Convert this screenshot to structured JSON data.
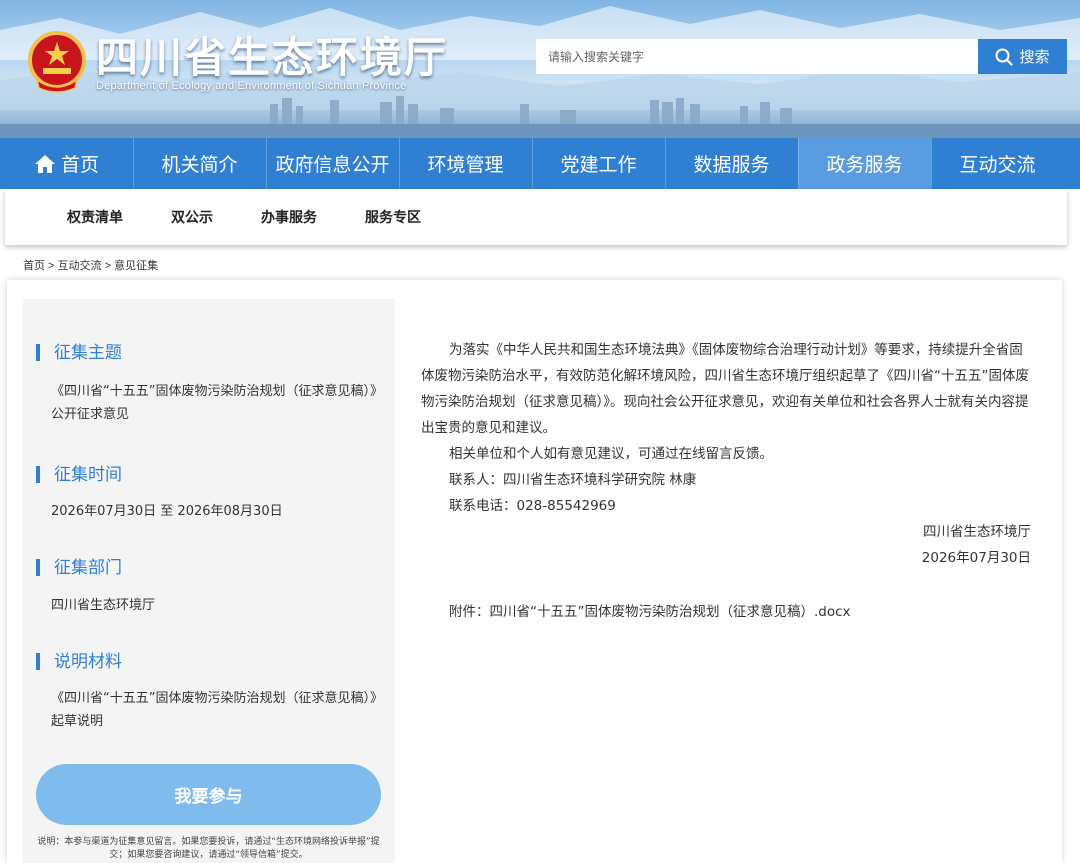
{
  "header": {
    "site_title": "四川省生态环境厅",
    "site_subtitle": "Department of Ecology and Environment of Sichuan Province",
    "search_placeholder": "请输入搜索关键字",
    "search_button": "搜索"
  },
  "nav": {
    "items": [
      {
        "label": "首页",
        "icon": "home-icon"
      },
      {
        "label": "机关简介"
      },
      {
        "label": "政府信息公开"
      },
      {
        "label": "环境管理"
      },
      {
        "label": "党建工作"
      },
      {
        "label": "数据服务"
      },
      {
        "label": "政务服务",
        "active": true
      },
      {
        "label": "互动交流"
      }
    ]
  },
  "subnav": {
    "items": [
      "权责清单",
      "双公示",
      "办事服务",
      "服务专区"
    ]
  },
  "breadcrumb": {
    "items": [
      "首页",
      "互动交流",
      "意见征集"
    ],
    "separator": " > "
  },
  "sidebar": {
    "topic_title": "征集主题",
    "topic_text": "《四川省“十五五”固体废物污染防治规划（征求意见稿）》公开征求意见",
    "time_title": "征集时间",
    "time_text": "2026年07月30日 至 2026年08月30日",
    "dept_title": "征集部门",
    "dept_text": "四川省生态环境厅",
    "material_title": "说明材料",
    "material_text": "《四川省“十五五”固体废物污染防治规划（征求意见稿）》起草说明",
    "participate_button": "我要参与",
    "note": "说明：本参与渠道为征集意见留言。如果您要投诉，请通过“生态环境网络投诉举报”提交；如果您要咨询建议，请通过“领导信箱”提交。"
  },
  "content": {
    "paragraph1": "为落实《中华人民共和国生态环境法典》《固体废物综合治理行动计划》等要求，持续提升全省固体废物污染防治水平，有效防范化解环境风险，四川省生态环境厅组织起草了《四川省“十五五”固体废物污染防治规划（征求意见稿）》。现向社会公开征求意见，欢迎有关单位和社会各界人士就有关内容提出宝贵的意见和建议。",
    "paragraph2": "相关单位和个人如有意见建议，可通过在线留言反馈。",
    "contact": "联系人：四川省生态环境科学研究院 林康",
    "phone": "联系电话：028-85542969",
    "sign_org": "四川省生态环境厅",
    "sign_date": "2026年07月30日",
    "attachment": "附件：四川省“十五五”固体废物污染防治规划（征求意见稿）.docx"
  },
  "colors": {
    "primary": "#2f7fd3",
    "nav_active": "#5a9ce0",
    "button": "#7fbbec"
  }
}
